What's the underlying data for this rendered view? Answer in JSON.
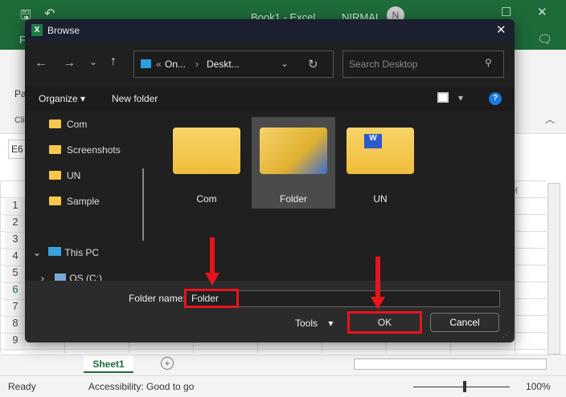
{
  "excel": {
    "title": "Book1 - Excel",
    "user": "NIRMAL",
    "avatar": "N",
    "file_tab": "F",
    "paste": "Pa",
    "clipboard": "Cli",
    "namebox": "E6",
    "col_h": "H",
    "rows": [
      "1",
      "2",
      "3",
      "4",
      "5",
      "6",
      "7",
      "8",
      "9"
    ],
    "sheet": "Sheet1",
    "status": "Ready",
    "accessibility": "Accessibility: Good to go",
    "zoom": "100%"
  },
  "dialog": {
    "title": "Browse",
    "breadcrumb": [
      "On...",
      "Deskt..."
    ],
    "search_placeholder": "Search Desktop",
    "organize": "Organize",
    "new_folder": "New folder",
    "nav": [
      {
        "label": "Com"
      },
      {
        "label": "Screenshots"
      },
      {
        "label": "UN"
      },
      {
        "label": "Sample"
      },
      {
        "label": "This PC"
      },
      {
        "label": "OS (C:)"
      }
    ],
    "items": [
      {
        "label": "Com"
      },
      {
        "label": "Folder"
      },
      {
        "label": "UN"
      }
    ],
    "folder_name_label": "Folder name:",
    "folder_name_value": "Folder",
    "tools": "Tools",
    "ok": "OK",
    "cancel": "Cancel"
  },
  "colors": {
    "excel_green": "#1e6b3a",
    "highlight": "#e8141c"
  }
}
